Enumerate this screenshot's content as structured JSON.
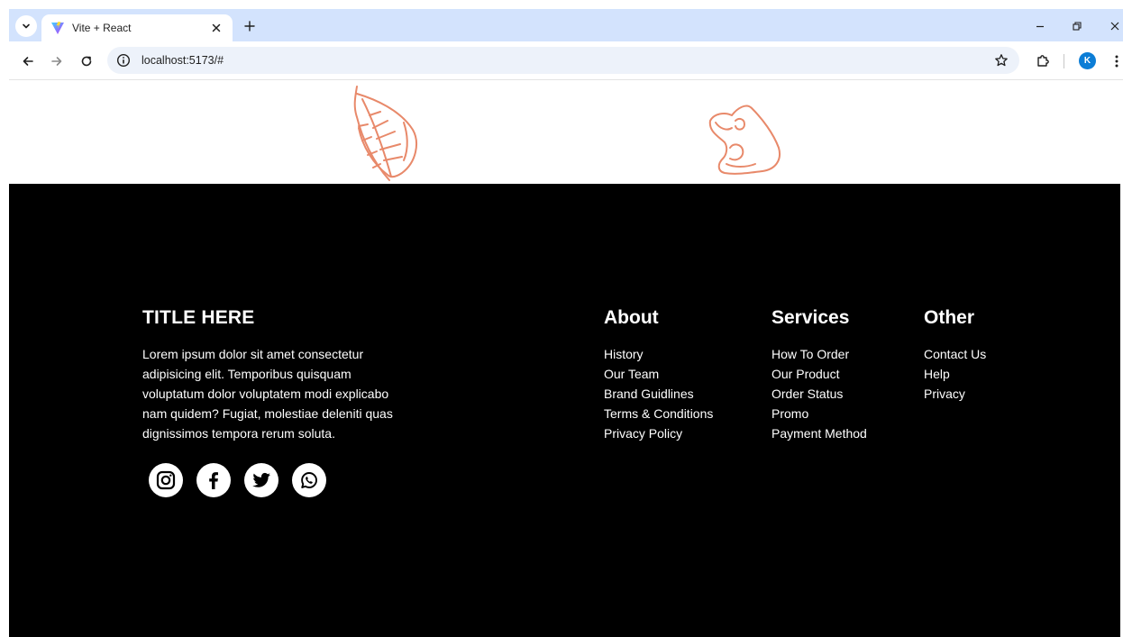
{
  "browser": {
    "tab_title": "Vite + React",
    "url": "localhost:5173/#",
    "profile_initial": "K"
  },
  "colors": {
    "footer_bg": "#000000",
    "footer_text": "#ffffff",
    "decoration_stroke": "#e8896a",
    "profile_badge": "#0b7dd6"
  },
  "decorations": [
    "leaf-illustration",
    "mushroom-illustration"
  ],
  "footer": {
    "brand": {
      "title": "TITLE HERE",
      "description": "Lorem ipsum dolor sit amet consectetur adipisicing elit. Temporibus quisquam voluptatum dolor voluptatem modi explicabo nam quidem? Fugiat, molestiae deleniti quas dignissimos tempora rerum soluta."
    },
    "socials": [
      {
        "icon": "instagram-icon"
      },
      {
        "icon": "facebook-icon"
      },
      {
        "icon": "twitter-icon"
      },
      {
        "icon": "whatsapp-icon"
      }
    ],
    "about": {
      "title": "About",
      "links": [
        "History",
        "Our Team",
        "Brand Guidlines",
        "Terms & Conditions",
        "Privacy Policy"
      ]
    },
    "services": {
      "title": "Services",
      "links": [
        "How To Order",
        "Our Product",
        "Order Status",
        "Promo",
        "Payment Method"
      ]
    },
    "other": {
      "title": "Other",
      "links": [
        "Contact Us",
        "Help",
        "Privacy"
      ]
    }
  }
}
